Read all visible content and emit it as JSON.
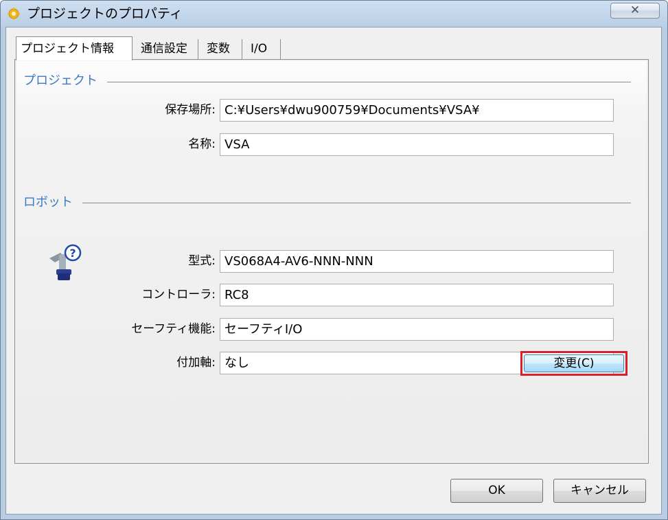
{
  "window": {
    "title": "プロジェクトのプロパティ",
    "close_label": "✕"
  },
  "tabs": [
    {
      "label": "プロジェクト情報",
      "active": true
    },
    {
      "label": "通信設定",
      "active": false
    },
    {
      "label": "変数",
      "active": false
    },
    {
      "label": "I/O",
      "active": false
    }
  ],
  "project_group": {
    "title": "プロジェクト",
    "location_label": "保存場所:",
    "location_value": "C:¥Users¥dwu900759¥Documents¥VSA¥",
    "name_label": "名称:",
    "name_value": "VSA"
  },
  "robot_group": {
    "title": "ロボット",
    "icon": "robot-arm-help-icon",
    "model_label": "型式:",
    "model_value": "VS068A4-AV6-NNN-NNN",
    "controller_label": "コントローラ:",
    "controller_value": "RC8",
    "safety_label": "セーフティ機能:",
    "safety_value": "セーフティI/O",
    "axis_label": "付加軸:",
    "axis_value": "なし",
    "change_button": "変更(C)"
  },
  "footer": {
    "ok_label": "OK",
    "cancel_label": "キャンセル"
  },
  "colors": {
    "group_title": "#3b79c4",
    "highlight": "#d8202c"
  }
}
